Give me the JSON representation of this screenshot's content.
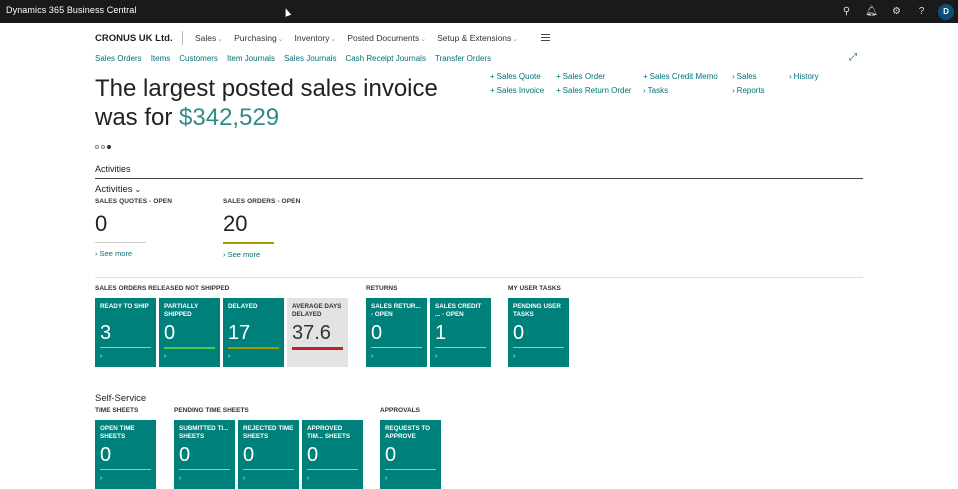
{
  "app": {
    "title": "Dynamics 365 Business Central",
    "avatar": "D"
  },
  "topbar_icons": [
    "search-icon",
    "bell-icon",
    "gear-icon",
    "help-icon"
  ],
  "company": "CRONUS UK Ltd.",
  "mainnav": [
    "Sales",
    "Purchasing",
    "Inventory",
    "Posted Documents",
    "Setup & Extensions"
  ],
  "subnav": [
    "Sales Orders",
    "Items",
    "Customers",
    "Item Journals",
    "Sales Journals",
    "Cash Receipt Journals",
    "Transfer Orders"
  ],
  "headline": {
    "text": "The largest posted sales invoice was for ",
    "amount": "$342,529"
  },
  "actions": {
    "col1": [
      "Sales Quote",
      "Sales Invoice"
    ],
    "col2": [
      "Sales Order",
      "Sales Return Order"
    ],
    "col3": [
      "Sales Credit Memo",
      "Tasks"
    ],
    "col4": [
      "Sales",
      "Reports"
    ],
    "col5": [
      "History"
    ]
  },
  "activities": {
    "section_title": "Activities",
    "sub_title": "Activities",
    "cues": [
      {
        "caption": "SALES QUOTES - OPEN",
        "value": "0",
        "see_more": "See more"
      },
      {
        "caption": "SALES ORDERS - OPEN",
        "value": "20",
        "see_more": "See more"
      }
    ]
  },
  "groups": {
    "released": "SALES ORDERS RELEASED NOT SHIPPED",
    "returns": "RETURNS",
    "user_tasks": "MY USER TASKS",
    "time_sheets": "TIME SHEETS",
    "pending_time_sheets": "PENDING TIME SHEETS",
    "approvals": "APPROVALS"
  },
  "tiles_row1": [
    {
      "label": "READY TO SHIP",
      "value": "3"
    },
    {
      "label": "PARTIALLY SHIPPED",
      "value": "0"
    },
    {
      "label": "DELAYED",
      "value": "17"
    },
    {
      "label": "AVERAGE DAYS DELAYED",
      "value": "37.6"
    },
    {
      "label": "SALES RETUR... - OPEN",
      "value": "0"
    },
    {
      "label": "SALES CREDIT ... - OPEN",
      "value": "1"
    },
    {
      "label": "PENDING USER TASKS",
      "value": "0"
    }
  ],
  "self_service": "Self-Service",
  "tiles_row2": [
    {
      "label": "OPEN TIME SHEETS",
      "value": "0"
    },
    {
      "label": "SUBMITTED TI... SHEETS",
      "value": "0"
    },
    {
      "label": "REJECTED TIME SHEETS",
      "value": "0"
    },
    {
      "label": "APPROVED TIM... SHEETS",
      "value": "0"
    },
    {
      "label": "REQUESTS TO APPROVE",
      "value": "0"
    }
  ],
  "colors": {
    "tile": "#00807a",
    "accent": "#00707a",
    "amount": "#2e8b88"
  }
}
